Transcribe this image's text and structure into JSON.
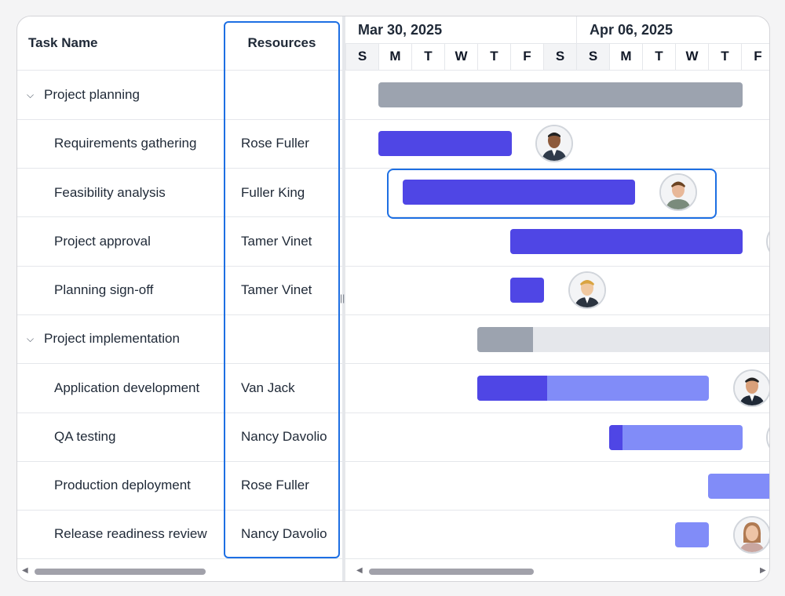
{
  "grid": {
    "columns": {
      "task": "Task Name",
      "resources": "Resources"
    },
    "rows": [
      {
        "name": "Project planning",
        "resource": "",
        "parent": true
      },
      {
        "name": "Requirements gathering",
        "resource": "Rose Fuller",
        "parent": false
      },
      {
        "name": "Feasibility analysis",
        "resource": "Fuller King",
        "parent": false
      },
      {
        "name": "Project approval",
        "resource": "Tamer Vinet",
        "parent": false
      },
      {
        "name": "Planning sign-off",
        "resource": "Tamer Vinet",
        "parent": false
      },
      {
        "name": "Project implementation",
        "resource": "",
        "parent": true
      },
      {
        "name": "Application development",
        "resource": "Van Jack",
        "parent": false
      },
      {
        "name": "QA testing",
        "resource": "Nancy Davolio",
        "parent": false
      },
      {
        "name": "Production deployment",
        "resource": "Rose Fuller",
        "parent": false
      },
      {
        "name": "Release readiness review",
        "resource": "Nancy Davolio",
        "parent": false
      }
    ],
    "expand_icon": "chevron-down-icon"
  },
  "timeline": {
    "weeks": [
      "Mar 30, 2025",
      "Apr 06, 2025"
    ],
    "days": [
      "S",
      "M",
      "T",
      "W",
      "T",
      "F",
      "S",
      "S",
      "M",
      "T",
      "W",
      "T",
      "F"
    ]
  },
  "colors": {
    "accent": "#1d6fe3",
    "task_bar": "#4f46e5",
    "task_bar_light": "#818cf8",
    "parent_bar": "#9ca3af"
  },
  "selected_row": "Feasibility analysis",
  "selected_column": "Resources"
}
